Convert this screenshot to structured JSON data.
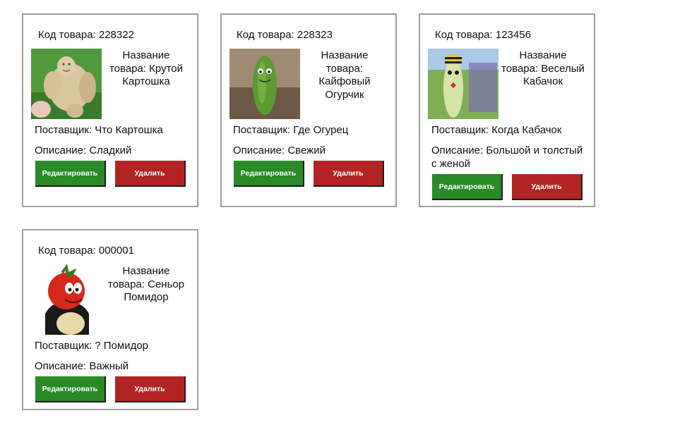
{
  "products": [
    {
      "code": "Код товара: 228322",
      "name": "Название товара: Крутой Картошка",
      "supplier": "Поставщик: Что Картошка",
      "description": "Описание: Сладкий",
      "image_icon": "potato-figure-image",
      "edit_label": "Редактировать",
      "delete_label": "Удалить"
    },
    {
      "code": "Код товара: 228323",
      "name": "Название товара: Кайфовый Огурчик",
      "supplier": "Поставщик: Где Огурец",
      "description": "Описание: Свежий",
      "image_icon": "cucumber-figure-image",
      "edit_label": "Редактировать",
      "delete_label": "Удалить"
    },
    {
      "code": "Код товара: 123456",
      "name": "Название товара: Веселый Кабачок",
      "supplier": "Поставщик: Когда Кабачок",
      "description": "Описание: Большой и толстый с женой",
      "image_icon": "zucchini-figure-image",
      "edit_label": "Редактировать",
      "delete_label": "Удалить"
    },
    {
      "code": "Код товара: 000001",
      "name": "Название товара: Сеньор Помидор",
      "supplier": "Поставщик: ? Помидор",
      "description": "Описание: Важный",
      "image_icon": "tomato-cartoon-image",
      "edit_label": "Редактировать",
      "delete_label": "Удалить"
    }
  ],
  "colors": {
    "edit_button": "#2a8a26",
    "delete_button": "#b22424",
    "card_border": "#9e9e9e"
  }
}
